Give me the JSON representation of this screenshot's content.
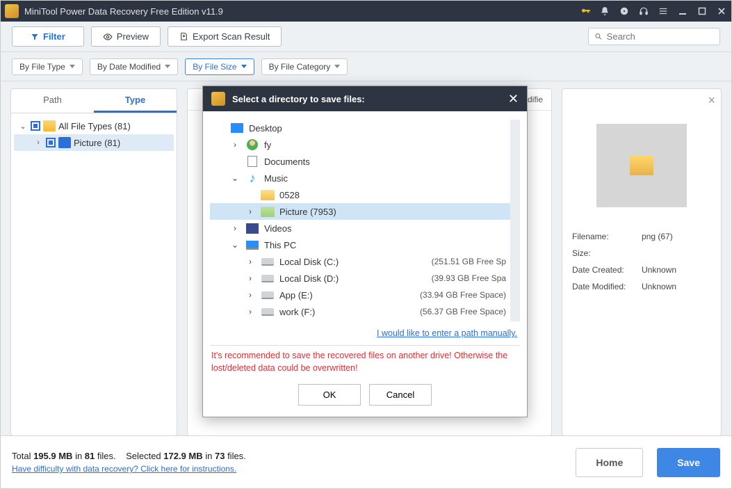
{
  "titlebar": {
    "title": "MiniTool Power Data Recovery Free Edition v11.9"
  },
  "toolbar": {
    "filter": "Filter",
    "preview": "Preview",
    "export": "Export Scan Result",
    "search_placeholder": "Search"
  },
  "chips": {
    "file_type": "By File Type",
    "date_modified": "By Date Modified",
    "file_size": "By File Size",
    "file_category": "By File Category"
  },
  "left": {
    "tab_path": "Path",
    "tab_type": "Type",
    "root": "All File Types (81)",
    "child": "Picture (81)"
  },
  "right": {
    "filename_k": "Filename:",
    "filename_v": "png (67)",
    "size_k": "Size:",
    "size_v": "",
    "created_k": "Date Created:",
    "created_v": "Unknown",
    "modified_k": "Date Modified:",
    "modified_v": "Unknown"
  },
  "center_header_fragment": "odifie",
  "status": {
    "total_pre": "Total ",
    "total_size": "195.9 MB",
    "total_mid": " in ",
    "total_count": "81",
    "total_post": " files.",
    "sel_pre": "Selected ",
    "sel_size": "172.9 MB",
    "sel_mid": " in ",
    "sel_count": "73",
    "sel_post": " files.",
    "help": "Have difficulty with data recovery? Click here for instructions.",
    "home": "Home",
    "save": "Save"
  },
  "modal": {
    "title": "Select a directory to save files:",
    "manual": "I would like to enter a path manually.",
    "warn": "It's recommended to save the recovered files on another drive! Otherwise the lost/deleted data could be overwritten!",
    "ok": "OK",
    "cancel": "Cancel",
    "tree": [
      {
        "indent": 0,
        "chev": "",
        "icon": "desktop",
        "label": "Desktop",
        "free": ""
      },
      {
        "indent": 1,
        "chev": "›",
        "icon": "user",
        "label": "fy",
        "free": ""
      },
      {
        "indent": 1,
        "chev": "",
        "icon": "doc",
        "label": "Documents",
        "free": ""
      },
      {
        "indent": 1,
        "chev": "⌄",
        "icon": "music",
        "label": "Music",
        "free": ""
      },
      {
        "indent": 2,
        "chev": "",
        "icon": "folder",
        "label": "0528",
        "free": ""
      },
      {
        "indent": 2,
        "chev": "›",
        "icon": "folder-sel",
        "label": "Picture (7953)",
        "free": "",
        "selected": true
      },
      {
        "indent": 1,
        "chev": "›",
        "icon": "video",
        "label": "Videos",
        "free": ""
      },
      {
        "indent": 1,
        "chev": "⌄",
        "icon": "pc",
        "label": "This PC",
        "free": ""
      },
      {
        "indent": 2,
        "chev": "›",
        "icon": "disk",
        "label": "Local Disk (C:)",
        "free": "(251.51 GB Free Sp"
      },
      {
        "indent": 2,
        "chev": "›",
        "icon": "disk",
        "label": "Local Disk (D:)",
        "free": "(39.93 GB Free Spa"
      },
      {
        "indent": 2,
        "chev": "›",
        "icon": "disk",
        "label": "App (E:)",
        "free": "(33.94 GB Free Space)"
      },
      {
        "indent": 2,
        "chev": "›",
        "icon": "disk",
        "label": "work (F:)",
        "free": "(56.37 GB Free Space)"
      }
    ]
  }
}
